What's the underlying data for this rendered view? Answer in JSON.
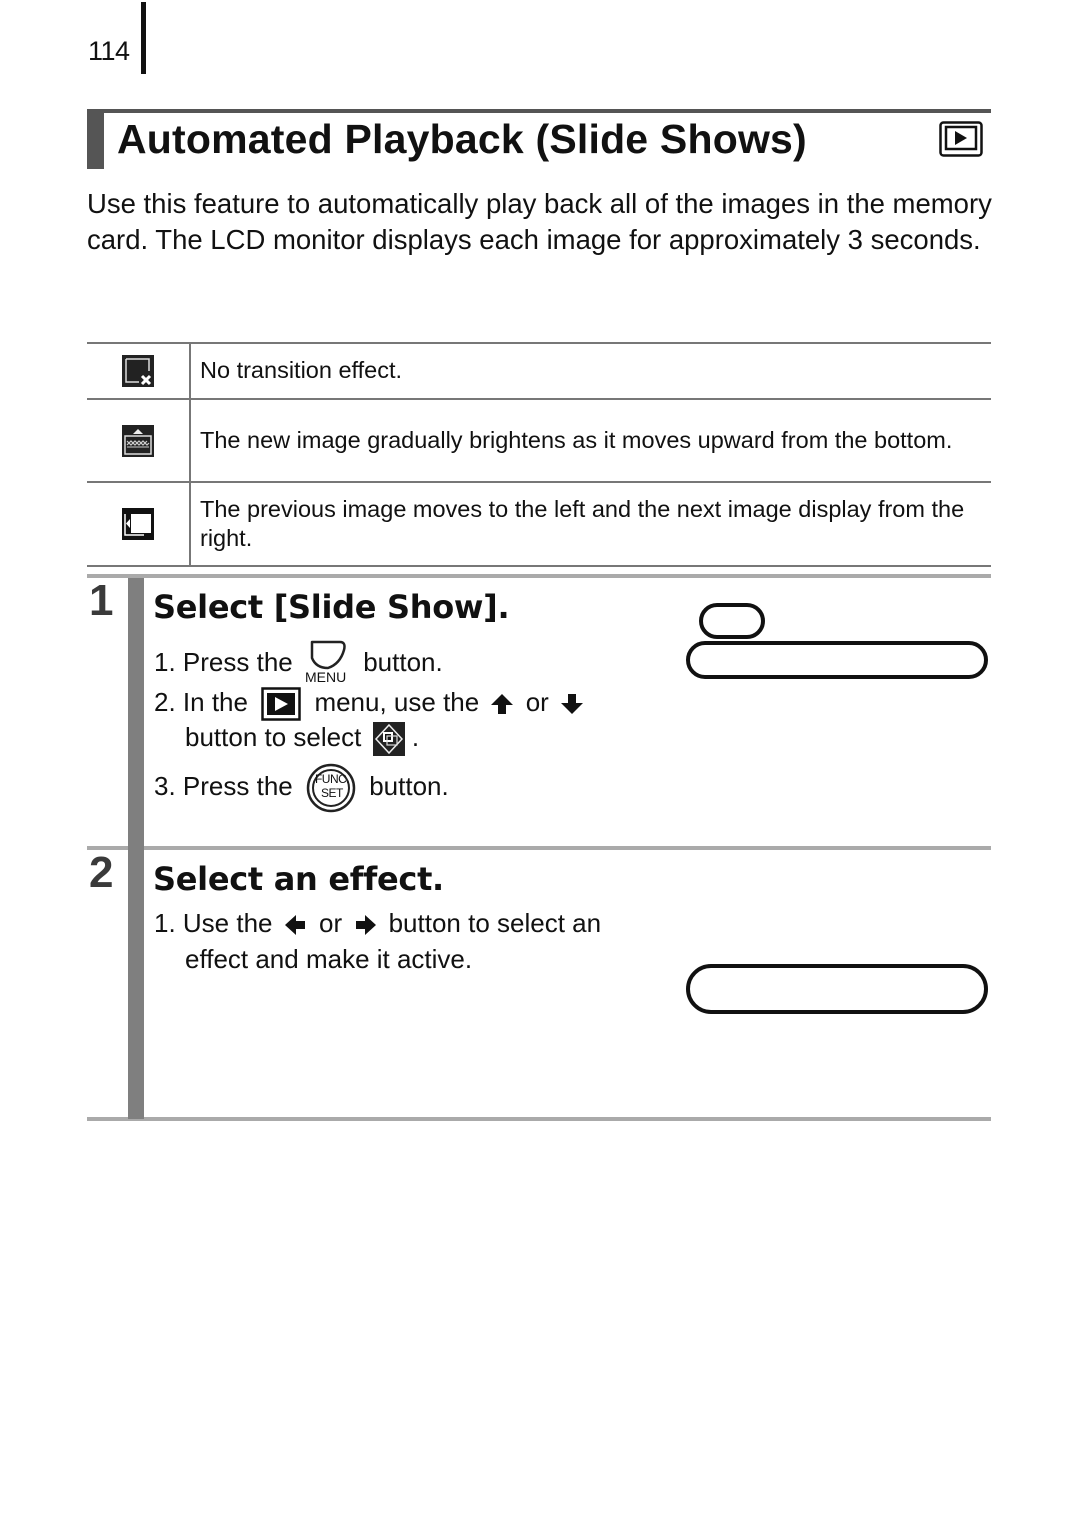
{
  "page": {
    "number": "114"
  },
  "title": {
    "text": "Automated Playback (Slide Shows)",
    "mode_icon": "playback-mode-icon"
  },
  "intro": "Use this feature to automatically play back all of the images in the memory card. The LCD monitor displays each image for approximately 3 seconds.",
  "effects_table": {
    "rows": [
      {
        "icon": "no-transition-icon",
        "description": "No transition effect."
      },
      {
        "icon": "fade-up-transition-icon",
        "description": "The new image gradually brightens as it moves upward from the bottom."
      },
      {
        "icon": "slide-left-transition-icon",
        "description": "The previous image moves to the left and the next image display from the right."
      }
    ]
  },
  "steps": [
    {
      "number": "1",
      "heading": "Select [Slide Show].",
      "instructions": {
        "l1": {
          "a": "1. Press the",
          "icon_label": "MENU",
          "b": "button."
        },
        "l2": {
          "a": "2. In the",
          "b": "menu, use the",
          "c": "or"
        },
        "l3": {
          "a": "button to select",
          "b": "."
        },
        "l4": {
          "a": "3. Press the",
          "icon_label_top": "FUNC.",
          "icon_label_bottom": "SET",
          "b": "button."
        }
      }
    },
    {
      "number": "2",
      "heading": "Select an effect.",
      "instructions": {
        "l1": {
          "a": "1. Use the",
          "b": "or",
          "c": "button to select an"
        },
        "l2": {
          "a": "effect and make it active."
        }
      }
    }
  ],
  "colors": {
    "rule": "#555555",
    "step_bar": "#7f7f7f",
    "step_rule": "#aaaaaa",
    "table_rule": "#777777"
  }
}
